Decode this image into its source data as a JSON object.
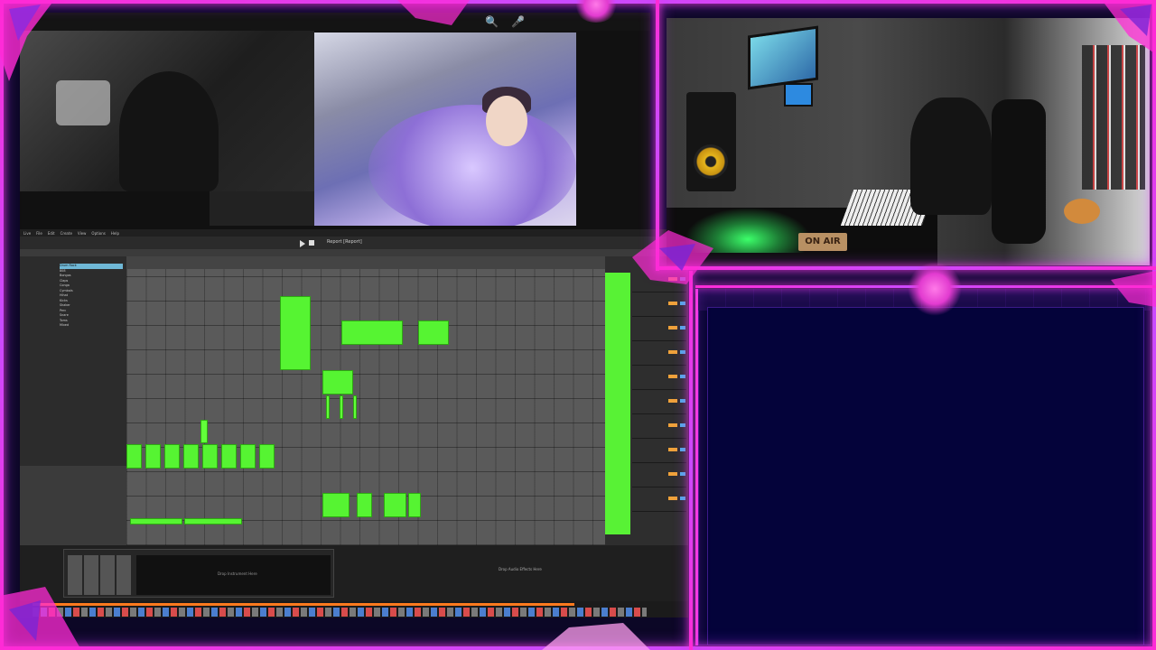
{
  "scene": {
    "accent_color": "#ff2bd6",
    "secondary_color": "#b63cff",
    "daw_clip_color": "#56f432"
  },
  "browser": {
    "icons": [
      "search-icon",
      "microphone-icon"
    ]
  },
  "daw": {
    "menu": [
      "Live",
      "File",
      "Edit",
      "Create",
      "View",
      "Options",
      "Help"
    ],
    "project_title": "Report [Report]",
    "browser_items": [
      "Drum Rack",
      "808",
      "Bongos",
      "Claps",
      "Conga",
      "Cymbals",
      "Hihat",
      "Kicks",
      "Shaker",
      "Perc",
      "Snare",
      "Toms",
      "Mixed"
    ],
    "detail_drop_text": "Drop Audio Effects Here",
    "device_screen_text": "Drop Instrument Here"
  },
  "studio": {
    "sign_text": "ON AIR"
  }
}
